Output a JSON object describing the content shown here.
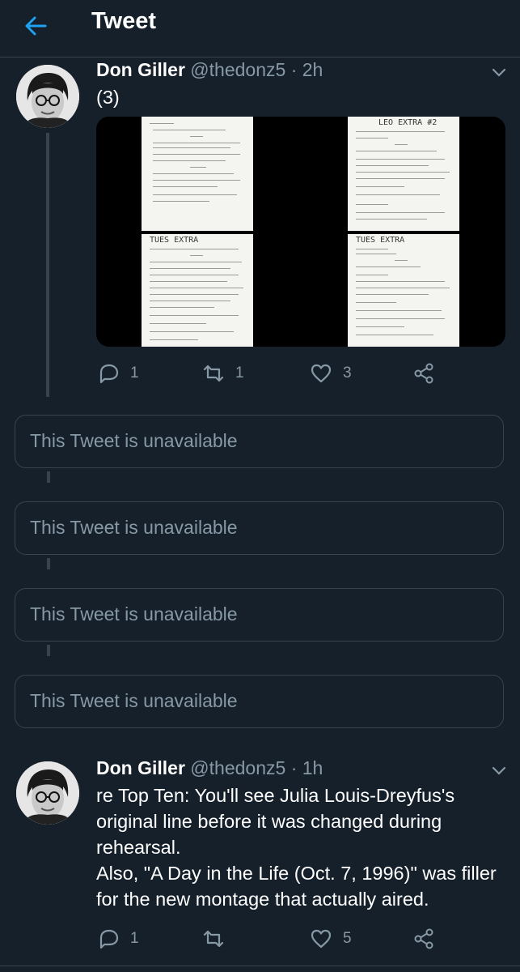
{
  "header": {
    "title": "Tweet",
    "back_icon": "arrow-left-icon"
  },
  "colors": {
    "background": "#15202b",
    "accent": "#1da1f2",
    "secondary_text": "#8899a6",
    "border": "#38444d"
  },
  "tweets": [
    {
      "name": "Don Giller",
      "handle": "@thedonz5",
      "separator": "·",
      "time": "2h",
      "text": "(3)",
      "media_count": 4,
      "media_headings": [
        "",
        "LEO EXTRA #2",
        "TUES EXTRA",
        "TUES EXTRA"
      ],
      "replies": "1",
      "retweets": "1",
      "likes": "3"
    },
    {
      "name": "Don Giller",
      "handle": "@thedonz5",
      "separator": "·",
      "time": "1h",
      "text": "re Top Ten: You'll see Julia Louis-Dreyfus's original line before it was changed during rehearsal.\nAlso, \"A Day in the Life (Oct. 7, 1996)\" was filler for the new montage that actually aired.",
      "replies": "1",
      "retweets": "",
      "likes": "5"
    }
  ],
  "unavailable": [
    "This Tweet is unavailable",
    "This Tweet is unavailable",
    "This Tweet is unavailable",
    "This Tweet is unavailable"
  ]
}
